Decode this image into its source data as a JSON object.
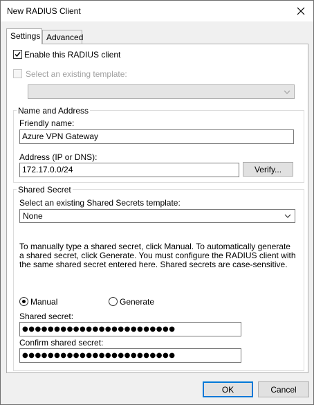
{
  "window": {
    "title": "New RADIUS Client"
  },
  "tabs": [
    {
      "label": "Settings",
      "active": true
    },
    {
      "label": "Advanced",
      "active": false
    }
  ],
  "settings": {
    "enable_client": {
      "label": "Enable this RADIUS client",
      "checked": true
    },
    "existing_template": {
      "label": "Select an existing template:",
      "checked": false,
      "enabled": false,
      "value": ""
    },
    "name_address": {
      "group_title": "Name and Address",
      "friendly_name_label": "Friendly name:",
      "friendly_name_value": "Azure VPN Gateway",
      "address_label": "Address (IP or DNS):",
      "address_value": "172.17.0.0/24",
      "verify_label": "Verify..."
    },
    "shared_secret": {
      "group_title": "Shared Secret",
      "template_label": "Select an existing Shared Secrets template:",
      "template_value": "None",
      "description": "To manually type a shared secret, click Manual. To automatically generate a shared secret, click Generate. You must configure the RADIUS client with the same shared secret entered here. Shared secrets are case-sensitive.",
      "manual_label": "Manual",
      "generate_label": "Generate",
      "selected_mode": "Manual",
      "secret_label": "Shared secret:",
      "secret_value": "●●●●●●●●●●●●●●●●●●●●●●●●",
      "confirm_label": "Confirm shared secret:",
      "confirm_value": "●●●●●●●●●●●●●●●●●●●●●●●●"
    }
  },
  "buttons": {
    "ok": "OK",
    "cancel": "Cancel"
  }
}
